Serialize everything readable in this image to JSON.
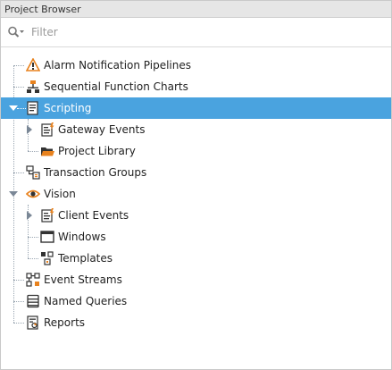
{
  "panel": {
    "title": "Project Browser"
  },
  "filter": {
    "placeholder": "Filter"
  },
  "tree": {
    "alarm_pipelines": "Alarm Notification Pipelines",
    "sfc": "Sequential Function Charts",
    "scripting": "Scripting",
    "gateway_events": "Gateway Events",
    "project_library": "Project Library",
    "transaction_groups": "Transaction Groups",
    "vision": "Vision",
    "client_events": "Client Events",
    "windows": "Windows",
    "templates": "Templates",
    "event_streams": "Event Streams",
    "named_queries": "Named Queries",
    "reports": "Reports"
  },
  "colors": {
    "selection": "#4aa3df",
    "accent_orange": "#e8821e"
  },
  "icons": {
    "alarm_pipelines": "pipeline-warning-icon",
    "sfc": "sfc-icon",
    "scripting": "script-document-icon",
    "gateway_events": "event-script-icon",
    "project_library": "open-folder-icon",
    "transaction_groups": "transaction-group-icon",
    "vision": "vision-eye-icon",
    "client_events": "event-script-icon",
    "windows": "window-icon",
    "templates": "template-icon",
    "event_streams": "event-stream-icon",
    "named_queries": "database-icon",
    "reports": "report-icon"
  }
}
